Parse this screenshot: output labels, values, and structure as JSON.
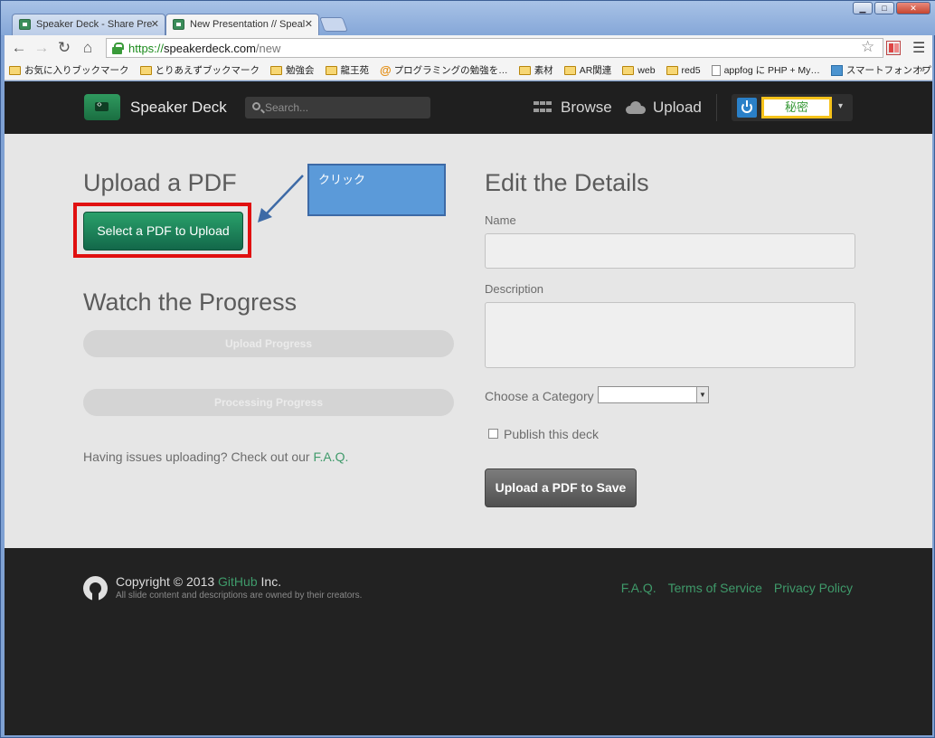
{
  "browser": {
    "tabs": [
      {
        "label": "Speaker Deck - Share Pre"
      },
      {
        "label": "New Presentation // Speal"
      }
    ],
    "url": {
      "scheme": "https://",
      "host": "speakerdeck.com",
      "path": "/new"
    },
    "bookmarks": [
      {
        "label": "お気に入りブックマーク",
        "icon": "folder-icon"
      },
      {
        "label": "とりあえずブックマーク",
        "icon": "folder-icon"
      },
      {
        "label": "勉強会",
        "icon": "folder-icon"
      },
      {
        "label": "龍王苑",
        "icon": "folder-icon"
      },
      {
        "label": "プログラミングの勉強を…",
        "icon": "at-icon"
      },
      {
        "label": "素材",
        "icon": "folder-icon"
      },
      {
        "label": "AR関連",
        "icon": "folder-icon"
      },
      {
        "label": "web",
        "icon": "folder-icon"
      },
      {
        "label": "red5",
        "icon": "folder-icon"
      },
      {
        "label": "appfog に PHP + My…",
        "icon": "document-icon"
      },
      {
        "label": "スマートフォンオプション…",
        "icon": "image-icon"
      }
    ],
    "more": "»"
  },
  "site": {
    "brand": "Speaker Deck",
    "search_placeholder": "Search...",
    "nav": {
      "browse": "Browse",
      "upload": "Upload"
    },
    "user_label": "秘密",
    "caret": "▾"
  },
  "upload": {
    "title": "Upload a PDF",
    "button": "Select a PDF to Upload",
    "callout": "クリック",
    "progress_title": "Watch the Progress",
    "upload_progress": "Upload Progress",
    "processing_progress": "Processing Progress",
    "help_text": "Having issues uploading? Check out our ",
    "help_link": "F.A.Q."
  },
  "details": {
    "title": "Edit the Details",
    "name_label": "Name",
    "description_label": "Description",
    "category_label": "Choose a Category",
    "publish_label": "Publish this deck",
    "save_button": "Upload a PDF to Save"
  },
  "footer": {
    "copyright_pre": "Copyright © 2013 ",
    "copyright_link": "GitHub",
    "copyright_post": " Inc.",
    "owned": "All slide content and descriptions are owned by their creators.",
    "links": [
      "F.A.Q.",
      "Terms of Service",
      "Privacy Policy"
    ]
  }
}
